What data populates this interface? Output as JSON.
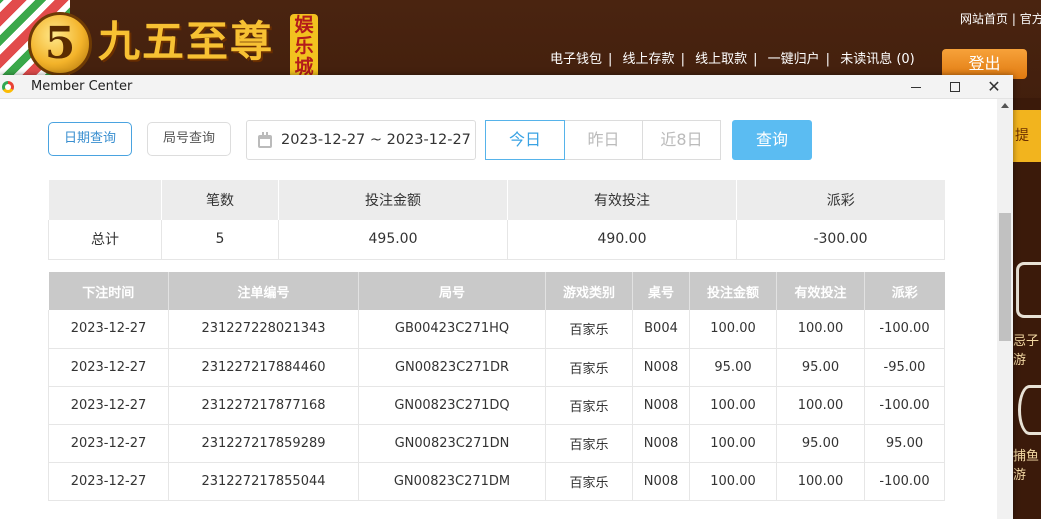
{
  "background_site": {
    "logo_badge": "5",
    "logo_text": "九五至尊",
    "logo_sub": "娱乐城",
    "top_links": [
      "网站首页",
      "官方"
    ],
    "nav": [
      "电子钱包",
      "线上存款",
      "线上取款",
      "一键归户",
      "未读讯息 (0)"
    ],
    "login_button": "登出",
    "right_side_text": [
      "忌子游",
      "捕鱼游"
    ]
  },
  "window": {
    "title": "Member Center",
    "minimize_label": "",
    "maximize_label": "",
    "close_label": "✕"
  },
  "filters": {
    "tabs": [
      "日期查询",
      "局号查询"
    ],
    "active_tab": "日期查询",
    "date_range": "2023-12-27 ~ 2023-12-27",
    "range_buttons": [
      "今日",
      "昨日",
      "近8日"
    ],
    "active_range": "今日",
    "query_button": "查询"
  },
  "summary": {
    "headers": [
      "",
      "笔数",
      "投注金额",
      "有效投注",
      "派彩"
    ],
    "row": [
      "总计",
      "5",
      "495.00",
      "490.00",
      "-300.00"
    ]
  },
  "detail": {
    "headers": [
      "下注时间",
      "注单编号",
      "局号",
      "游戏类别",
      "桌号",
      "投注金额",
      "有效投注",
      "派彩"
    ],
    "rows": [
      [
        "2023-12-27",
        "231227228021343",
        "GB00423C271HQ",
        "百家乐",
        "B004",
        "100.00",
        "100.00",
        "-100.00"
      ],
      [
        "2023-12-27",
        "231227217884460",
        "GN00823C271DR",
        "百家乐",
        "N008",
        "95.00",
        "95.00",
        "-95.00"
      ],
      [
        "2023-12-27",
        "231227217877168",
        "GN00823C271DQ",
        "百家乐",
        "N008",
        "100.00",
        "100.00",
        "-100.00"
      ],
      [
        "2023-12-27",
        "231227217859289",
        "GN00823C271DN",
        "百家乐",
        "N008",
        "100.00",
        "95.00",
        "95.00"
      ],
      [
        "2023-12-27",
        "231227217855044",
        "GN00823C271DM",
        "百家乐",
        "N008",
        "100.00",
        "100.00",
        "-100.00"
      ]
    ]
  },
  "colors": {
    "accent_blue": "#5bbcf2",
    "negative_red": "#e8454a",
    "header_gray": "#c9c9c9"
  }
}
